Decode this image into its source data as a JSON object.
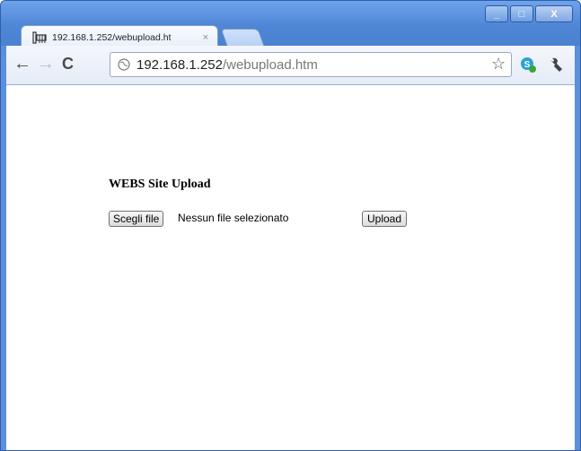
{
  "browser": {
    "tab_title": "192.168.1.252/webupload.ht",
    "tab_close": "×",
    "url_host": "192.168.1.252",
    "url_path": "/webupload.htm",
    "icons": {
      "back": "back-arrow-icon",
      "forward": "forward-arrow-icon",
      "reload": "reload-icon",
      "star": "bookmark-star-icon",
      "skype": "skype-icon",
      "wrench": "wrench-icon"
    }
  },
  "window_controls": {
    "minimize": "_",
    "maximize": "□",
    "close": "X"
  },
  "page": {
    "title": "WEBS Site Upload",
    "choose_label": "Scegli file",
    "no_file_text": "Nessun file selezionato",
    "upload_label": "Upload"
  },
  "colors": {
    "frame": "#5a8fdc",
    "toolbar": "#e5ecf6"
  }
}
